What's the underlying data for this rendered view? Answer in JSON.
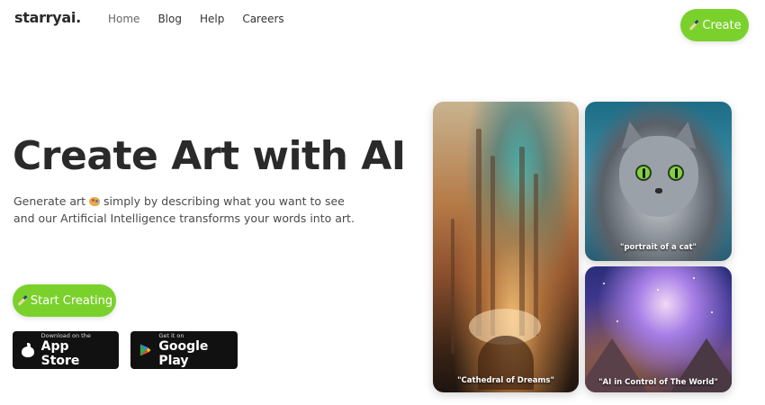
{
  "brand": {
    "name": "starryai",
    "dot": "."
  },
  "nav": {
    "items": [
      "Home",
      "Blog",
      "Help",
      "Careers"
    ]
  },
  "header": {
    "create_label": "Create"
  },
  "hero": {
    "title": "Create Art with AI",
    "subtitle_part1": "Generate art",
    "subtitle_part2": "simply by describing what you want to see and our Artificial Intelligence transforms your words into art.",
    "start_label": "Start Creating"
  },
  "stores": {
    "app_small": "Download on the",
    "app_big": "App Store",
    "play_small": "Get it on",
    "play_big": "Google Play"
  },
  "gallery": {
    "captions": [
      "\"Cathedral of Dreams\"",
      "\"portrait of a cat\"",
      "\"AI in Control of The World\""
    ]
  },
  "colors": {
    "accent": "#7ad12c",
    "dark": "#111111"
  }
}
